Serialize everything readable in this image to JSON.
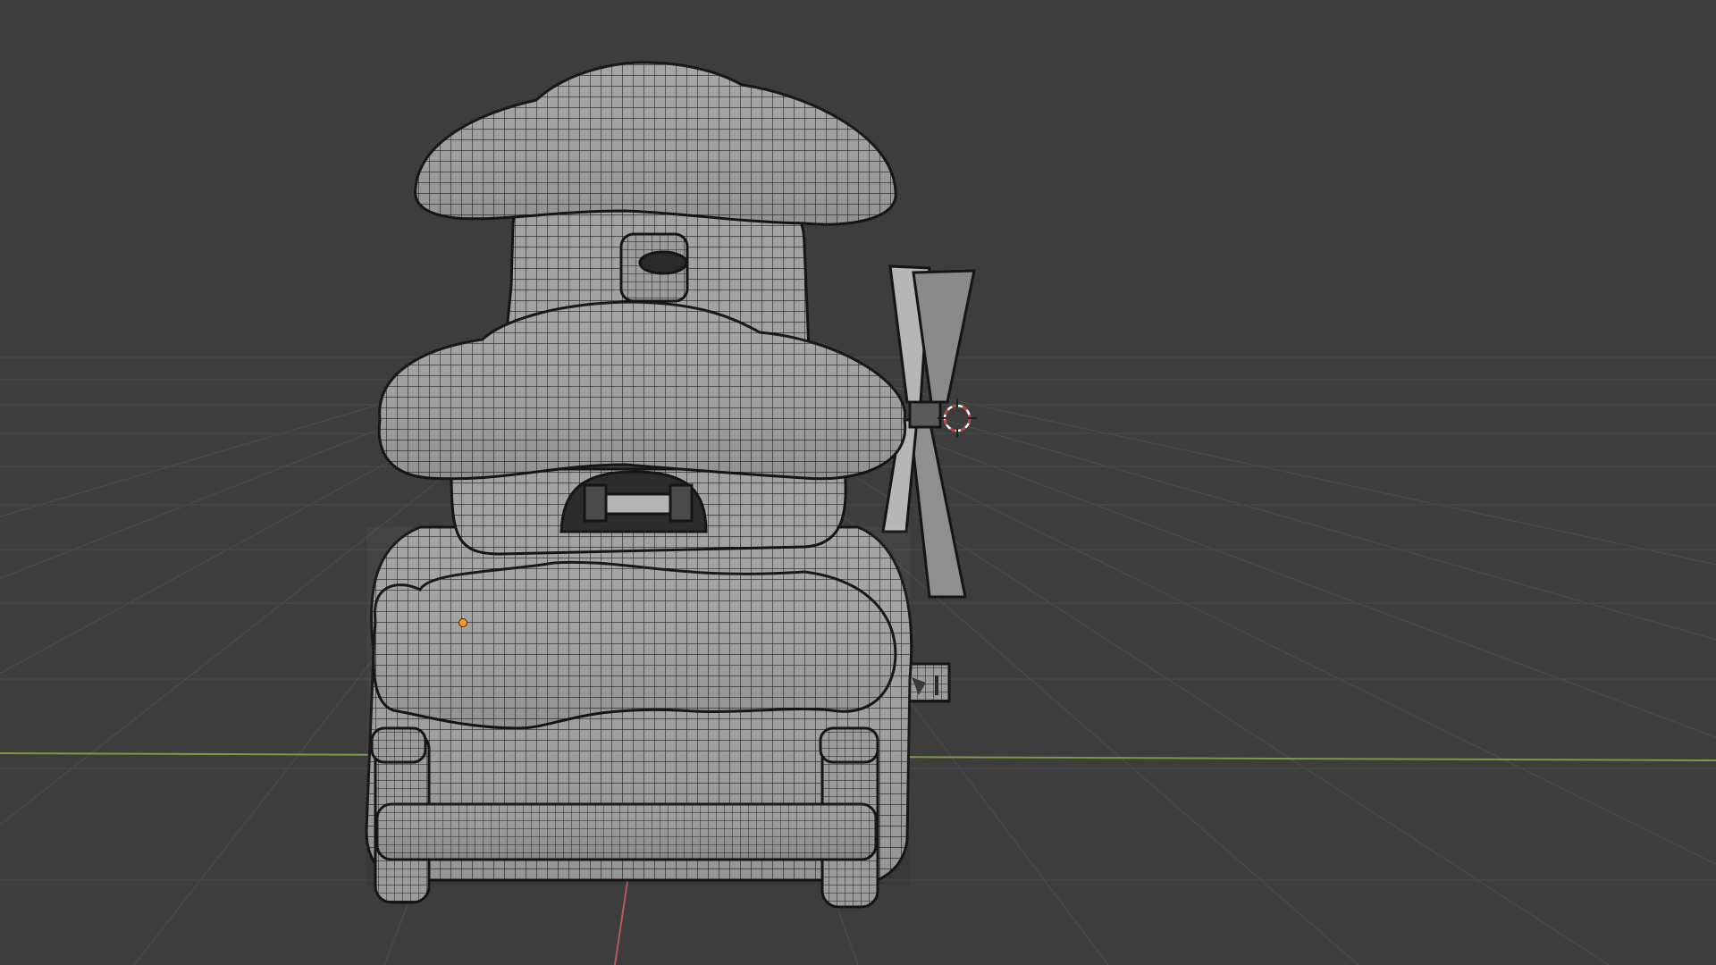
{
  "viewport": {
    "label": "",
    "background_color": "#3d3d3d",
    "grid_color": "#4a4a4a",
    "axis_x_color": "#7a9a43",
    "axis_y_color": "#b35a5a",
    "mesh_fill_color": "#9d9d9d",
    "wire_color": "#1a1a1a",
    "cursor_color": "#c43b3b",
    "selected_vertex_color": "#ff9a1f"
  },
  "scene": {
    "object": "mushroom-house-mesh",
    "parts": [
      "top-cap",
      "tower-body",
      "tower-window",
      "middle-cap",
      "middle-window",
      "lower-cap",
      "base",
      "front-beam",
      "windmill-blades",
      "side-sign"
    ]
  },
  "gizmos": {
    "cursor_icon": "3d-cursor-icon",
    "selected_vertex_icon": "selected-vertex-icon"
  }
}
